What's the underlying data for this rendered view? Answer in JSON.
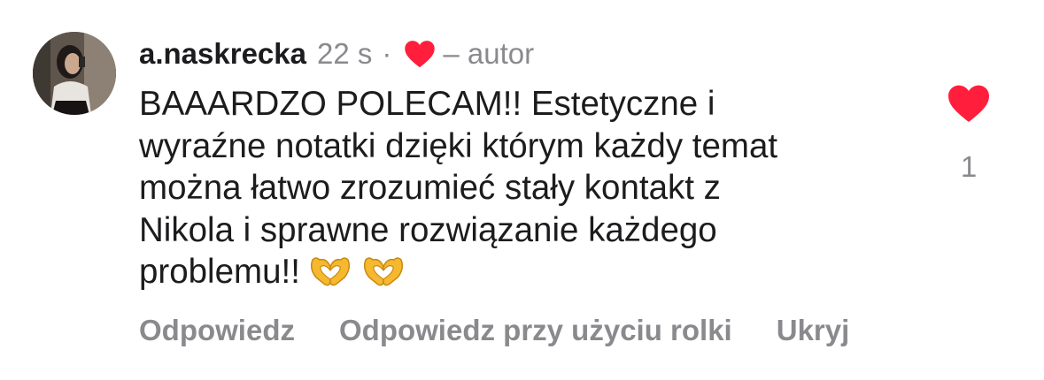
{
  "comment": {
    "username": "a.naskrecka",
    "time": "22 s",
    "separator": "·",
    "author_label": "– autor",
    "text_lines": [
      "BAAARDZO POLECAM!! Estetyczne i",
      "wyraźne notatki dzięki którym każdy temat",
      "można łatwo zrozumieć stały kontakt z",
      "Nikola i sprawne rozwiązanie każdego",
      "problemu!!"
    ],
    "like_count": "1",
    "actions": {
      "reply": "Odpowiedz",
      "reply_with_reel": "Odpowiedz przy użyciu rolki",
      "hide": "Ukryj"
    }
  },
  "colors": {
    "heart_red": "#ff1f3d",
    "secondary_text": "#8a8a8e",
    "primary_text": "#1c1c1e"
  },
  "icons": {
    "author_liked": "heart-icon",
    "like": "heart-icon",
    "emoji": "heart-hands-emoji"
  }
}
